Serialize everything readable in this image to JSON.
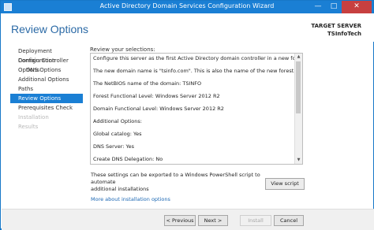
{
  "window": {
    "title": "Active Directory Domain Services Configuration Wizard",
    "controls": {
      "minimize": "—",
      "maximize": "□",
      "close": "✕"
    }
  },
  "header": {
    "page_title": "Review Options",
    "target_server_label": "TARGET SERVER",
    "target_server_name": "TSInfoTech"
  },
  "nav": {
    "items": [
      {
        "label": "Deployment Configuration",
        "state": "normal",
        "indent": false
      },
      {
        "label": "Domain Controller Options",
        "state": "normal",
        "indent": false
      },
      {
        "label": "DNS Options",
        "state": "normal",
        "indent": true
      },
      {
        "label": "Additional Options",
        "state": "normal",
        "indent": false
      },
      {
        "label": "Paths",
        "state": "normal",
        "indent": false
      },
      {
        "label": "Review Options",
        "state": "active",
        "indent": false
      },
      {
        "label": "Prerequisites Check",
        "state": "normal",
        "indent": false
      },
      {
        "label": "Installation",
        "state": "disabled",
        "indent": false
      },
      {
        "label": "Results",
        "state": "disabled",
        "indent": false
      }
    ]
  },
  "main": {
    "subheading": "Review your selections:",
    "review_lines": [
      "Configure this server as the first Active Directory domain controller in a new forest.",
      "",
      "The new domain name is \"tsinfo.com\". This is also the name of the new forest.",
      "",
      "The NetBIOS name of the domain: TSINFO",
      "",
      "Forest Functional Level: Windows Server 2012 R2",
      "",
      "Domain Functional Level: Windows Server 2012 R2",
      "",
      "Additional Options:",
      "",
      "Global catalog: Yes",
      "",
      "DNS Server: Yes",
      "",
      "Create DNS Delegation: No"
    ],
    "export_note_line1": "These settings can be exported to a Windows PowerShell script to automate",
    "export_note_line2": "additional installations",
    "view_script_label": "View script",
    "more_link": "More about installation options"
  },
  "footer": {
    "previous_label": "< Previous",
    "next_label": "Next >",
    "install_label": "Install",
    "cancel_label": "Cancel"
  },
  "colors": {
    "accent": "#1a7fd4",
    "title_text": "#2b6aa6",
    "close_button": "#c74040",
    "link": "#1a66b3"
  }
}
